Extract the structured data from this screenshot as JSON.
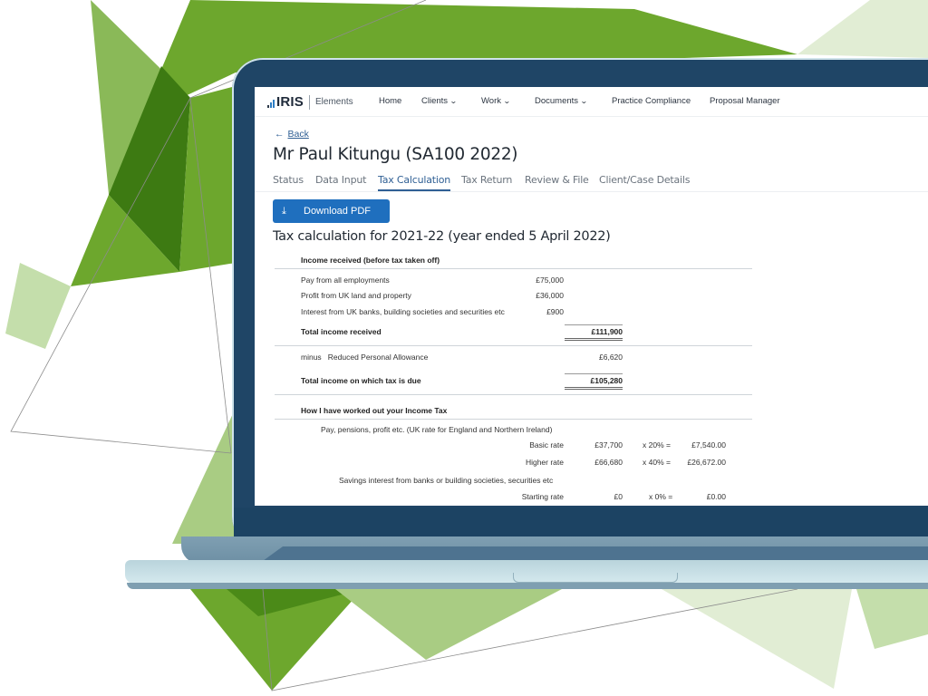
{
  "app": {
    "logo_text": "IRIS",
    "logo_subtitle": "Elements",
    "nav": [
      {
        "label": "Home",
        "has_dropdown": false
      },
      {
        "label": "Clients",
        "has_dropdown": true
      },
      {
        "label": "Work",
        "has_dropdown": true
      },
      {
        "label": "Documents",
        "has_dropdown": true
      },
      {
        "label": "Practice Compliance",
        "has_dropdown": false
      },
      {
        "label": "Proposal Manager",
        "has_dropdown": false
      }
    ],
    "chevron_glyph": "⌄"
  },
  "page": {
    "back_label": "Back",
    "back_arrow": "←",
    "title": "Mr Paul Kitungu (SA100 2022)",
    "tabs": [
      {
        "label": "Status",
        "active": false
      },
      {
        "label": "Data Input",
        "active": false
      },
      {
        "label": "Tax Calculation",
        "active": true
      },
      {
        "label": "Tax Return",
        "active": false
      },
      {
        "label": "Review & File",
        "active": false
      },
      {
        "label": "Client/Case Details",
        "active": false
      }
    ],
    "download_button": {
      "label": "Download PDF",
      "icon": "download-icon",
      "glyph": "⤓"
    },
    "section_title": "Tax calculation for 2021-22 (year ended 5 April 2022)"
  },
  "calculation": {
    "income_header": "Income received (before tax taken off)",
    "income_items": [
      {
        "label": "Pay from all employments",
        "amount": "£75,000"
      },
      {
        "label": "Profit from UK land and property",
        "amount": "£36,000"
      },
      {
        "label": "Interest from UK banks, building societies and securities etc",
        "amount": "£900"
      }
    ],
    "total_income": {
      "label": "Total income received",
      "amount": "£111,900"
    },
    "allowance": {
      "prefix": "minus",
      "label": "Reduced Personal Allowance",
      "amount": "£6,620"
    },
    "total_taxable": {
      "label": "Total income on which tax is due",
      "amount": "£105,280"
    },
    "workings_header": "How I have worked out your Income Tax",
    "pay_group_label": "Pay, pensions, profit etc. (UK rate for England and Northern Ireland)",
    "pay_bands": [
      {
        "band": "Basic rate",
        "amount": "£37,700",
        "rate": "x 20% =",
        "tax": "£7,540.00"
      },
      {
        "band": "Higher rate",
        "amount": "£66,680",
        "rate": "x 40% =",
        "tax": "£26,672.00"
      }
    ],
    "savings_group_label": "Savings interest from banks or building societies, securities etc",
    "savings_bands": [
      {
        "band": "Starting rate",
        "amount": "£0",
        "rate": "x 0% =",
        "tax": "£0.00"
      }
    ]
  },
  "colors": {
    "brand_blue": "#1f6fbe",
    "link_blue": "#2f5f94",
    "laptop_frame": "#1f4566",
    "green_dark": "#3d7a12",
    "green_mid": "#6da72d",
    "green_light": "#a9cc83",
    "green_pale": "#e1edd4"
  }
}
